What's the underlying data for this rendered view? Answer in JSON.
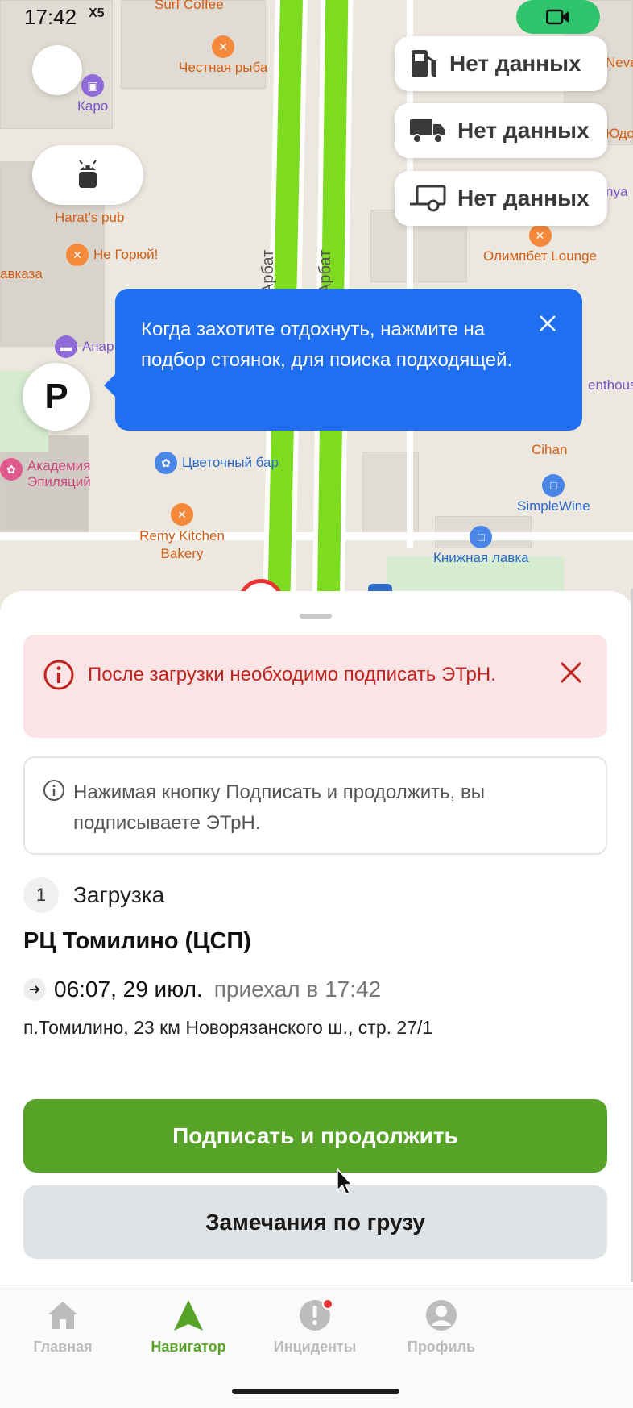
{
  "status_bar": {
    "time": "17:42",
    "carrier_label": "X5"
  },
  "map": {
    "street_label_1": "Арбат",
    "street_label_2": "Арбат",
    "pois": [
      {
        "name": "Surf Coffee",
        "color": "orange"
      },
      {
        "name": "Честная рыба",
        "color": "orange"
      },
      {
        "name": "Каро",
        "color": "purple"
      },
      {
        "name": "Harat's pub",
        "color": "orange"
      },
      {
        "name": "Не Горюй!",
        "color": "orange"
      },
      {
        "name": "авказа",
        "color": "orange"
      },
      {
        "name": "Апар",
        "color": "purple"
      },
      {
        "name": "Академия Эпиляций",
        "color": "pink"
      },
      {
        "name": "Цветочный бар",
        "color": "blue"
      },
      {
        "name": "Remy Kitchen Bakery",
        "color": "orange"
      },
      {
        "name": "Олимпбет Lounge",
        "color": "orange"
      },
      {
        "name": "Cihan",
        "color": "orange"
      },
      {
        "name": "SimpleWine",
        "color": "blue"
      },
      {
        "name": "Книжная лавка",
        "color": "blue"
      },
      {
        "name": "Юдо",
        "color": "orange"
      },
      {
        "name": "Neve",
        "color": "orange"
      },
      {
        "name": "nya",
        "color": "purple"
      },
      {
        "name": "enthous",
        "color": "purple"
      }
    ],
    "info_chips": [
      {
        "label": "Нет данных",
        "icon": "fuel-icon"
      },
      {
        "label": "Нет данных",
        "icon": "truck-icon"
      },
      {
        "label": "Нет данных",
        "icon": "trailer-icon"
      }
    ],
    "parking_button_label": "P",
    "tooltip_text": "Когда захотите отдохнуть, нажмите на подбор стоянок, для поиска подходящей."
  },
  "sheet": {
    "alert_text": "После загрузки необходимо подписать ЭТрН.",
    "note_text": "Нажимая кнопку Подписать и продолжить, вы подписываете ЭТрН.",
    "step_number": "1",
    "step_title": "Загрузка",
    "place_title": "РЦ Томилино (ЦСП)",
    "planned_time": "06:07, 29 июл.",
    "arrived_text": "приехал в 17:42",
    "address": "п.Томилино, 23 км Новорязанского ш., стр. 27/1",
    "primary_button": "Подписать и продолжить",
    "secondary_button": "Замечания по грузу"
  },
  "tabs": [
    {
      "label": "Главная",
      "icon": "home-icon",
      "active": false
    },
    {
      "label": "Навигатор",
      "icon": "navigator-icon",
      "active": true
    },
    {
      "label": "Инциденты",
      "icon": "incident-icon",
      "active": false,
      "badge": true
    },
    {
      "label": "Профиль",
      "icon": "profile-icon",
      "active": false
    }
  ],
  "colors": {
    "accent_green": "#56a328",
    "route_green": "#7ddc1f",
    "tooltip_blue": "#1f6ff0",
    "alert_red": "#c0231d",
    "alert_bg": "#fbe4e6",
    "camera_badge": "#2fc46c"
  }
}
